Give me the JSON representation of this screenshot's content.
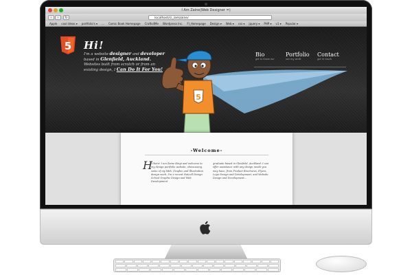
{
  "browser": {
    "window_title": "I Am Zaine|Web Designer =)",
    "url": "localhost/ci_iamzaine/",
    "bookmarks": [
      "Apple",
      "cool ideas ▾",
      "portfolio's ▾",
      "...",
      "Comic Book Homepage",
      "Crafts4Me",
      "Wordpress Inc.",
      "FI_Homepage",
      "Design ▾",
      "Web ▾",
      "css ▾",
      "jquery ▾",
      "PHP ▾",
      "v1 ▾",
      "Popular ▾"
    ]
  },
  "page": {
    "html5_logo_glyph": "5",
    "hero": {
      "greeting": "Hi!",
      "intro": {
        "p1": "I'm a website ",
        "w1": "designer",
        "p2": " and ",
        "w2": "developer",
        "p3": " based in ",
        "w3": "Glenfield, Auckland.",
        "p4": " Websites built from scratch or from an existing design, I ",
        "w4": "Can Do It For You!"
      }
    },
    "nav": [
      {
        "label": "Bio",
        "sub": "get to know me"
      },
      {
        "label": "Portfolio",
        "sub": "see my work"
      },
      {
        "label": "Contact",
        "sub": "get in touch"
      }
    ],
    "welcome": {
      "heading": "-Welcome-",
      "dropcap": "H",
      "col1": "i there! I am Zaine Kingi and welcome to my design portfolio website, showcasing some of my Web, Graphic and Illustration design work. I'm a recent Natcoll Design School Graphic Design and Web Development",
      "col2": "graduate based in Glenfield, Auckland. I can offer assistance with any design needs you may have, from Product Brochures, Flyers, Logo Design and Development, and Website Design and Development..."
    }
  },
  "colors": {
    "hero_dark": "#1e1e1e",
    "cape_blue": "#7fb4d8",
    "html5_orange": "#e44d26",
    "shirt_orange": "#f28f2c",
    "cap_blue": "#2a8fd1"
  }
}
